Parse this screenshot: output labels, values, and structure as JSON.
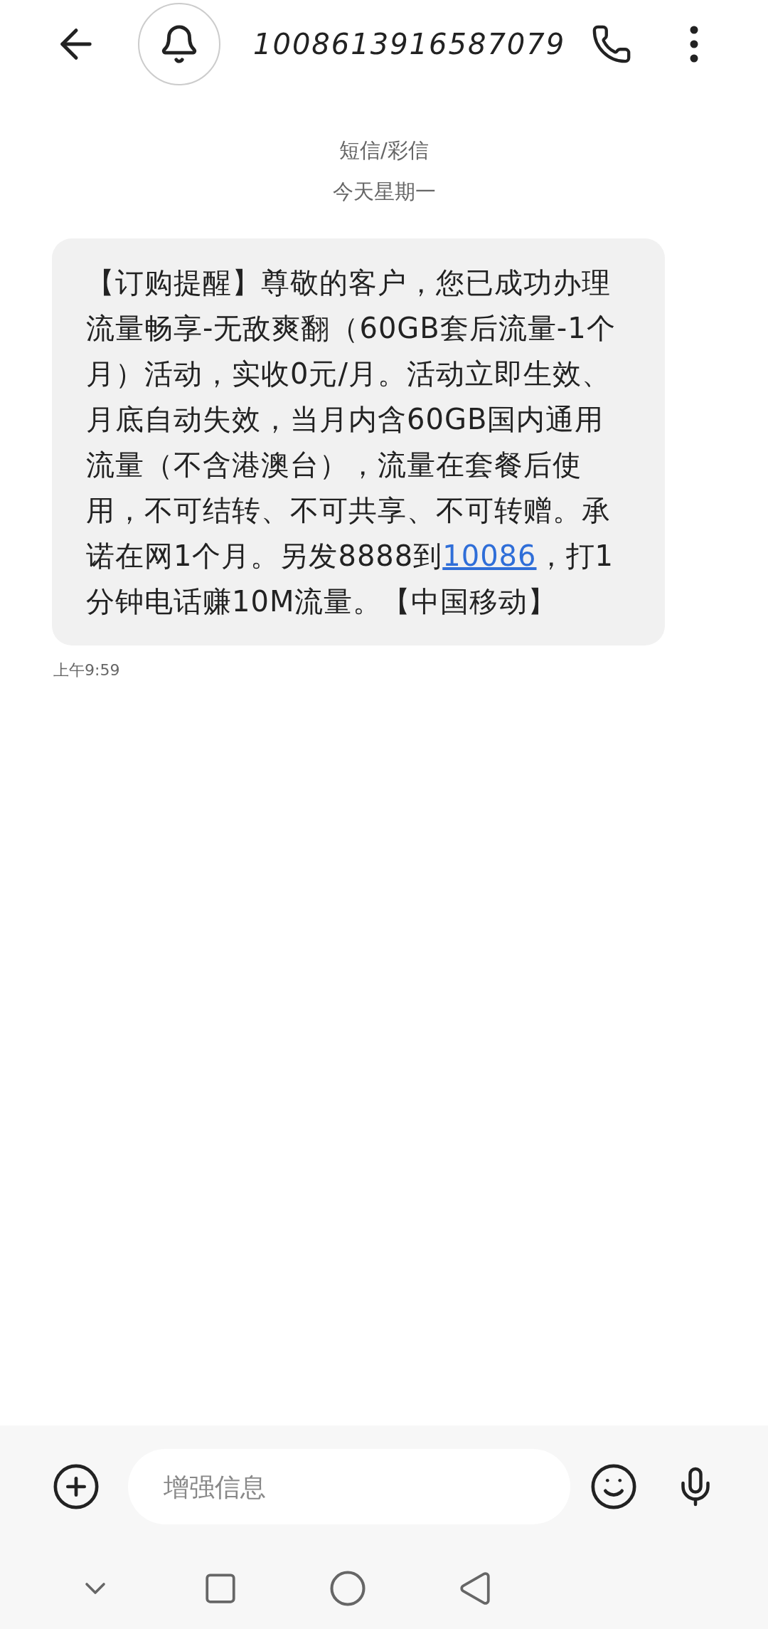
{
  "header": {
    "title": "1008613916587079"
  },
  "thread": {
    "type_label": "短信/彩信",
    "date": "今天星期一"
  },
  "message": {
    "parts": [
      {
        "kind": "text",
        "text": "【订购提醒】尊敬的客户，您已成功办理流量畅享-无敌爽翻（60GB套后流量-1个月）活动，实收0元/月。活动立即生效、月底自动失效，当月内含60GB国内通用流量（不含港澳台），流量在套餐后使用，不可结转、不可共享、不可转赠。承诺在网1个月。另发8888到"
      },
      {
        "kind": "link",
        "text": "10086"
      },
      {
        "kind": "text",
        "text": "，打1分钟电话赚10M流量。【中国移动】"
      }
    ],
    "time": "上午9:59"
  },
  "composer": {
    "placeholder": "增强信息"
  }
}
